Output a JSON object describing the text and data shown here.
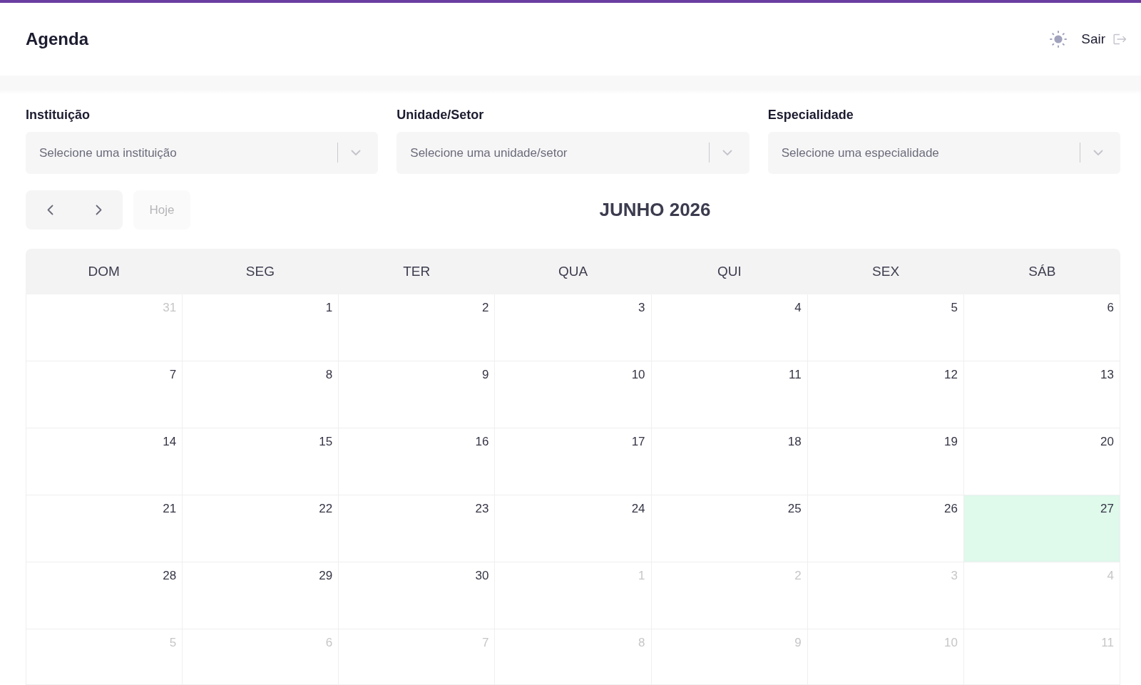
{
  "header": {
    "title": "Agenda",
    "logout_label": "Sair"
  },
  "filters": [
    {
      "label": "Instituição",
      "placeholder": "Selecione uma instituição"
    },
    {
      "label": "Unidade/Setor",
      "placeholder": "Selecione uma unidade/setor"
    },
    {
      "label": "Especialidade",
      "placeholder": "Selecione uma especialidade"
    }
  ],
  "toolbar": {
    "today_button": {
      "label": "Hoje",
      "disabled": true
    }
  },
  "calendar": {
    "title": "JUNHO 2026",
    "weekdays": [
      "DOM",
      "SEG",
      "TER",
      "QUA",
      "QUI",
      "SEX",
      "SÁB"
    ],
    "weeks": [
      [
        {
          "day": "31",
          "in_month": false,
          "today": false
        },
        {
          "day": "1",
          "in_month": true,
          "today": false
        },
        {
          "day": "2",
          "in_month": true,
          "today": false
        },
        {
          "day": "3",
          "in_month": true,
          "today": false
        },
        {
          "day": "4",
          "in_month": true,
          "today": false
        },
        {
          "day": "5",
          "in_month": true,
          "today": false
        },
        {
          "day": "6",
          "in_month": true,
          "today": false
        }
      ],
      [
        {
          "day": "7",
          "in_month": true,
          "today": false
        },
        {
          "day": "8",
          "in_month": true,
          "today": false
        },
        {
          "day": "9",
          "in_month": true,
          "today": false
        },
        {
          "day": "10",
          "in_month": true,
          "today": false
        },
        {
          "day": "11",
          "in_month": true,
          "today": false
        },
        {
          "day": "12",
          "in_month": true,
          "today": false
        },
        {
          "day": "13",
          "in_month": true,
          "today": false
        }
      ],
      [
        {
          "day": "14",
          "in_month": true,
          "today": false
        },
        {
          "day": "15",
          "in_month": true,
          "today": false
        },
        {
          "day": "16",
          "in_month": true,
          "today": false
        },
        {
          "day": "17",
          "in_month": true,
          "today": false
        },
        {
          "day": "18",
          "in_month": true,
          "today": false
        },
        {
          "day": "19",
          "in_month": true,
          "today": false
        },
        {
          "day": "20",
          "in_month": true,
          "today": false
        }
      ],
      [
        {
          "day": "21",
          "in_month": true,
          "today": false
        },
        {
          "day": "22",
          "in_month": true,
          "today": false
        },
        {
          "day": "23",
          "in_month": true,
          "today": false
        },
        {
          "day": "24",
          "in_month": true,
          "today": false
        },
        {
          "day": "25",
          "in_month": true,
          "today": false
        },
        {
          "day": "26",
          "in_month": true,
          "today": false
        },
        {
          "day": "27",
          "in_month": true,
          "today": true
        }
      ],
      [
        {
          "day": "28",
          "in_month": true,
          "today": false
        },
        {
          "day": "29",
          "in_month": true,
          "today": false
        },
        {
          "day": "30",
          "in_month": true,
          "today": false
        },
        {
          "day": "1",
          "in_month": false,
          "today": false
        },
        {
          "day": "2",
          "in_month": false,
          "today": false
        },
        {
          "day": "3",
          "in_month": false,
          "today": false
        },
        {
          "day": "4",
          "in_month": false,
          "today": false
        }
      ],
      [
        {
          "day": "5",
          "in_month": false,
          "today": false
        },
        {
          "day": "6",
          "in_month": false,
          "today": false
        },
        {
          "day": "7",
          "in_month": false,
          "today": false
        },
        {
          "day": "8",
          "in_month": false,
          "today": false
        },
        {
          "day": "9",
          "in_month": false,
          "today": false
        },
        {
          "day": "10",
          "in_month": false,
          "today": false
        },
        {
          "day": "11",
          "in_month": false,
          "today": false
        }
      ]
    ]
  }
}
